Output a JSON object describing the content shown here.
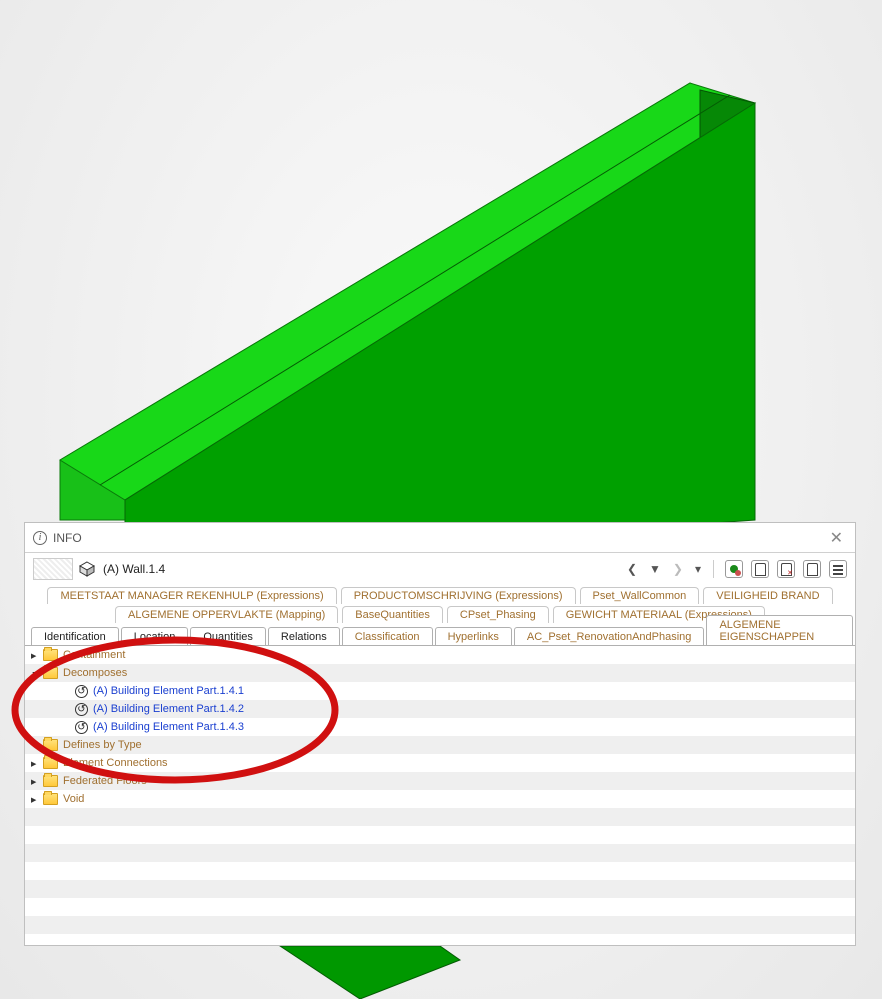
{
  "panel": {
    "title": "INFO",
    "object_name": "(A) Wall.1.4"
  },
  "pset_tabs_row1": [
    "MEETSTAAT MANAGER REKENHULP (Expressions)",
    "PRODUCTOMSCHRIJVING (Expressions)",
    "Pset_WallCommon",
    "VEILIGHEID BRAND"
  ],
  "pset_tabs_row2": [
    "ALGEMENE OPPERVLAKTE (Mapping)",
    "BaseQuantities",
    "CPset_Phasing",
    "GEWICHT MATERIAAL (Expressions)"
  ],
  "main_tabs": [
    {
      "label": "Identification",
      "style": "dark"
    },
    {
      "label": "Location",
      "style": "dark"
    },
    {
      "label": "Quantities",
      "style": "dark"
    },
    {
      "label": "Relations",
      "style": "dark",
      "selected": true
    },
    {
      "label": "Classification",
      "style": "light"
    },
    {
      "label": "Hyperlinks",
      "style": "light"
    },
    {
      "label": "AC_Pset_RenovationAndPhasing",
      "style": "light"
    },
    {
      "label": "ALGEMENE EIGENSCHAPPEN",
      "style": "light"
    }
  ],
  "tree": [
    {
      "alt": false,
      "arrow": "closed",
      "icon": "folder",
      "label": "Containment",
      "cls": "cat",
      "depth": 0
    },
    {
      "alt": true,
      "arrow": "open",
      "icon": "folder",
      "label": "Decomposes",
      "cls": "cat",
      "depth": 0
    },
    {
      "alt": false,
      "arrow": "none",
      "icon": "reverse",
      "label": "(A) Building Element Part.1.4.1",
      "cls": "item",
      "depth": 1
    },
    {
      "alt": true,
      "arrow": "none",
      "icon": "reverse",
      "label": "(A) Building Element Part.1.4.2",
      "cls": "item",
      "depth": 1
    },
    {
      "alt": false,
      "arrow": "none",
      "icon": "reverse",
      "label": "(A) Building Element Part.1.4.3",
      "cls": "item",
      "depth": 1
    },
    {
      "alt": true,
      "arrow": "none",
      "icon": "folder",
      "label": "Defines by Type",
      "cls": "cat",
      "depth": 0,
      "noarrow": true
    },
    {
      "alt": false,
      "arrow": "closed",
      "icon": "folder",
      "label": "Element Connections",
      "cls": "cat",
      "depth": 0
    },
    {
      "alt": true,
      "arrow": "closed",
      "icon": "folder",
      "label": "Federated Floors",
      "cls": "cat",
      "depth": 0
    },
    {
      "alt": false,
      "arrow": "closed",
      "icon": "folder",
      "label": "Void",
      "cls": "cat",
      "depth": 0
    },
    {
      "alt": true,
      "arrow": "",
      "icon": "",
      "label": "",
      "cls": "",
      "depth": 0
    },
    {
      "alt": false,
      "arrow": "",
      "icon": "",
      "label": "",
      "cls": "",
      "depth": 0
    },
    {
      "alt": true,
      "arrow": "",
      "icon": "",
      "label": "",
      "cls": "",
      "depth": 0
    },
    {
      "alt": false,
      "arrow": "",
      "icon": "",
      "label": "",
      "cls": "",
      "depth": 0
    },
    {
      "alt": true,
      "arrow": "",
      "icon": "",
      "label": "",
      "cls": "",
      "depth": 0
    },
    {
      "alt": false,
      "arrow": "",
      "icon": "",
      "label": "",
      "cls": "",
      "depth": 0
    },
    {
      "alt": true,
      "arrow": "",
      "icon": "",
      "label": "",
      "cls": "",
      "depth": 0
    }
  ]
}
